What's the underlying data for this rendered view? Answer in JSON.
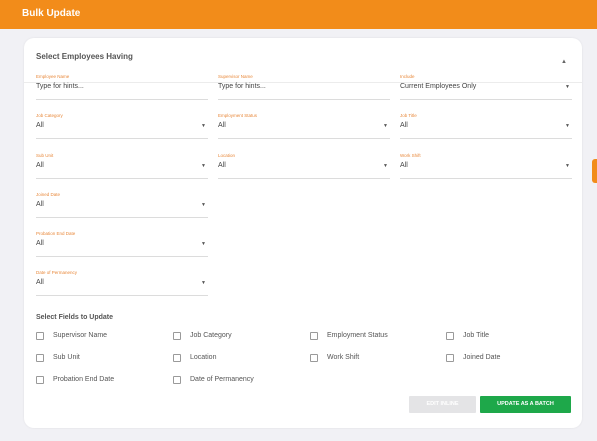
{
  "header": {
    "title": "Bulk Update"
  },
  "filters": {
    "title": "Select Employees Having",
    "fields": [
      {
        "label": "Employee Name",
        "value": "Type for hints..."
      },
      {
        "label": "Supervisor Name",
        "value": "Type for hints..."
      },
      {
        "label": "Include",
        "value": "Current Employees Only"
      },
      {
        "label": "Job Category",
        "value": "All"
      },
      {
        "label": "Employment Status",
        "value": "All"
      },
      {
        "label": "Job Title",
        "value": "All"
      },
      {
        "label": "Sub Unit",
        "value": "All"
      },
      {
        "label": "Location",
        "value": "All"
      },
      {
        "label": "Work Shift",
        "value": "All"
      },
      {
        "label": "Joined Date",
        "value": "All"
      },
      {
        "label": "Probation End Date",
        "value": "All"
      },
      {
        "label": "Date of Permanency",
        "value": "All"
      }
    ]
  },
  "update_fields": {
    "title": "Select Fields to Update",
    "options": [
      "Supervisor Name",
      "Job Category",
      "Employment Status",
      "Job Title",
      "Sub Unit",
      "Location",
      "Work Shift",
      "Joined Date",
      "Probation End Date",
      "Date of Permanency"
    ]
  },
  "actions": {
    "edit_inline": "EDIT INLINE",
    "update_batch": "UPDATE AS A BATCH"
  },
  "colors": {
    "accent": "#f28c1a",
    "primary_button": "#1ea84a",
    "disabled_button": "#e4e4e6",
    "label": "#e8883a"
  }
}
